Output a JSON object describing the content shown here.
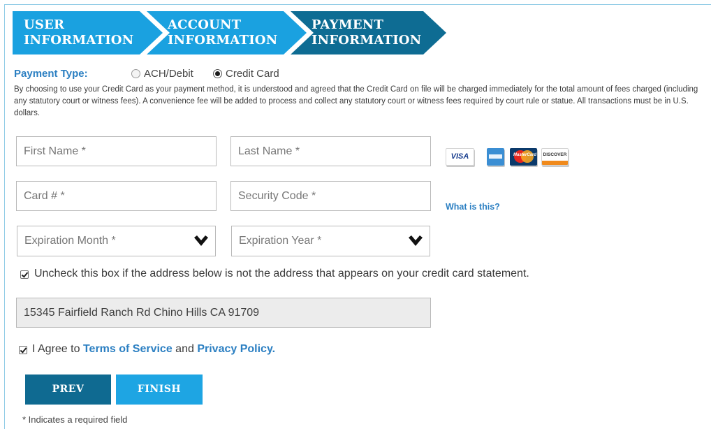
{
  "steps": [
    {
      "line1": "USER",
      "line2": "INFORMATION",
      "state": "complete",
      "color": "#1aa1e0"
    },
    {
      "line1": "ACCOUNT",
      "line2": "INFORMATION",
      "state": "complete",
      "color": "#1aa1e0"
    },
    {
      "line1": "PAYMENT",
      "line2": "INFORMATION",
      "state": "active",
      "color": "#0e6c93"
    }
  ],
  "payment_type": {
    "label": "Payment Type:",
    "options": [
      {
        "label": "ACH/Debit",
        "selected": false
      },
      {
        "label": "Credit Card",
        "selected": true
      }
    ]
  },
  "disclaimer": "By choosing to use your Credit Card as your payment method, it is understood and agreed that the Credit Card on file will be charged immediately for the total amount of fees charged (including any statutory court or witness fees). A convenience fee will be added to process and collect any statutory court or witness fees required by court rule or statue. All transactions must be in U.S. dollars.",
  "form": {
    "first_name_placeholder": "First Name *",
    "last_name_placeholder": "Last Name *",
    "card_number_placeholder": "Card # *",
    "security_code_placeholder": "Security Code *",
    "expiration_month_placeholder": "Expiration Month *",
    "expiration_year_placeholder": "Expiration Year *",
    "what_is_this": "What is this?",
    "address_checkbox_label": "Uncheck this box if the address below is not the address that appears on your credit card statement.",
    "address_checkbox_checked": true,
    "address_value": "15345 Fairfield Ranch Rd Chino Hills CA 91709",
    "agree_prefix": "I Agree to",
    "terms_link": "Terms of Service",
    "agree_and": "and",
    "privacy_link": "Privacy Policy.",
    "agree_checked": true
  },
  "cards": [
    {
      "name": "visa-card-icon",
      "text": "VISA"
    },
    {
      "name": "amex-card-icon",
      "text": ""
    },
    {
      "name": "mastercard-card-icon",
      "text": "MasterCard"
    },
    {
      "name": "discover-card-icon",
      "text": "DISCOVER"
    }
  ],
  "buttons": {
    "prev": "PREV",
    "finish": "FINISH"
  },
  "required_note": "* Indicates a required field",
  "colors": {
    "accent": "#2b7fc2",
    "step_light": "#1aa1e0",
    "step_dark": "#0e6c93",
    "prev_button": "#0f6a91",
    "finish_button": "#1ea5e3"
  }
}
